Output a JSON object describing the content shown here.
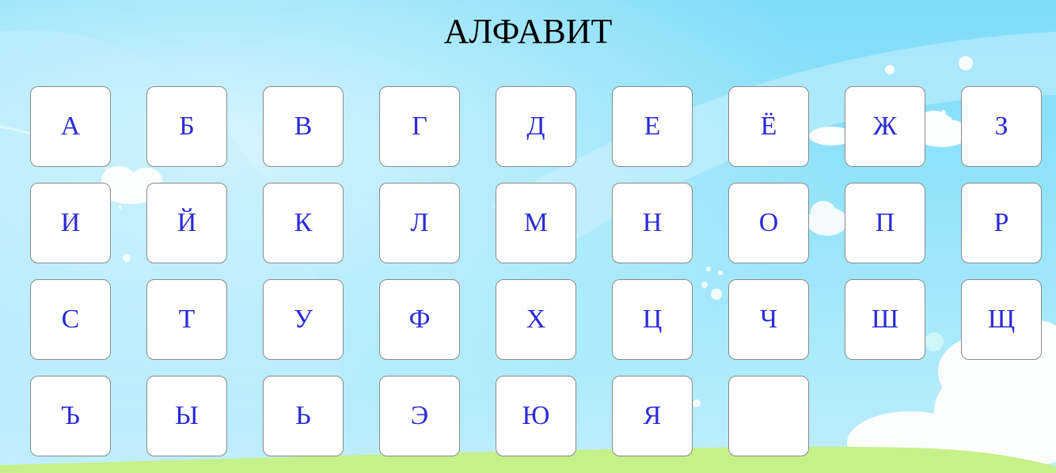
{
  "title": "АЛФАВИТ",
  "letters": [
    "А",
    "Б",
    "В",
    "Г",
    "Д",
    "Е",
    "Ё",
    "Ж",
    "З",
    "И",
    "Й",
    "К",
    "Л",
    "М",
    "Н",
    "О",
    "П",
    "Р",
    "С",
    "Т",
    "У",
    "Ф",
    "Х",
    "Ц",
    "Ч",
    "Ш",
    "Щ",
    "Ъ",
    "Ы",
    "Ь",
    "Э",
    "Ю",
    "Я",
    ""
  ],
  "colors": {
    "letter": "#2b2bd8",
    "tile_background": "#ffffff",
    "tile_border": "#8a8a8a",
    "sky": "#8fe2fb"
  }
}
